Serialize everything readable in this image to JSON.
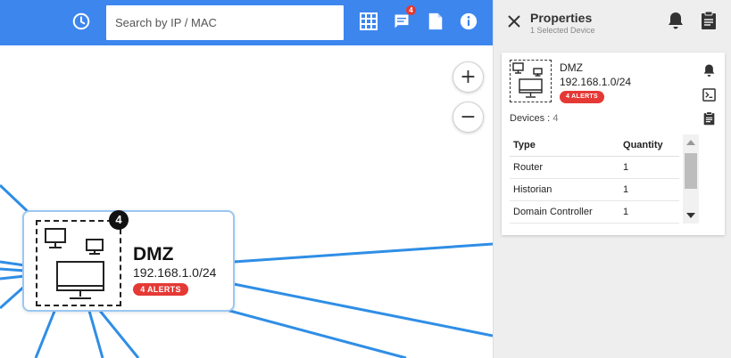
{
  "toolbar": {
    "search_placeholder": "Search by IP / MAC",
    "messages_badge": "4",
    "icons": [
      "history-icon",
      "grid-icon",
      "message-icon",
      "document-icon",
      "info-icon"
    ],
    "color": "#3d86ee"
  },
  "canvas": {
    "zoom_in_label": "+",
    "zoom_out_label": "−",
    "node": {
      "name": "DMZ",
      "subnet": "192.168.1.0/24",
      "alerts_label": "4 ALERTS",
      "device_count": "4",
      "border_color": "#9cc7f2"
    },
    "link_color": "#2f8ee6"
  },
  "panel": {
    "title": "Properties",
    "subtitle": "1 Selected Device",
    "card": {
      "name": "DMZ",
      "subnet": "192.168.1.0/24",
      "alerts_label": "4 ALERTS",
      "devices_label": "Devices :",
      "devices_count": "4",
      "table": {
        "headers": [
          "Type",
          "Quantity"
        ],
        "rows": [
          {
            "type": "Router",
            "quantity": "1"
          },
          {
            "type": "Historian",
            "quantity": "1"
          },
          {
            "type": "Domain Controller",
            "quantity": "1"
          }
        ]
      }
    },
    "alert_color": "#e53935"
  }
}
